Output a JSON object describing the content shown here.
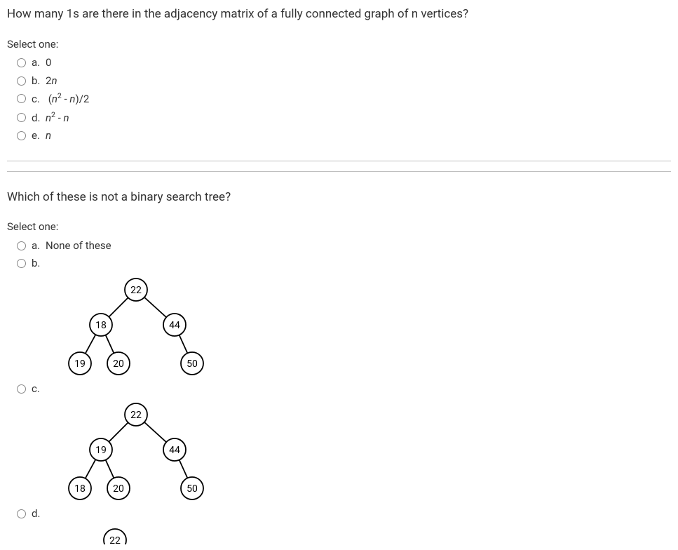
{
  "q1": {
    "text": "How many 1s are there in the adjacency matrix of a fully connected graph of n vertices?",
    "select": "Select one:",
    "opt_a": "0",
    "opt_b": "2n",
    "opt_c": "(n² - n)/2",
    "opt_d": "n² - n",
    "opt_e": "n"
  },
  "q2": {
    "text": "Which of these is not a binary search tree?",
    "select": "Select one:",
    "opt_a": "None of these"
  },
  "trees": {
    "tree_b": {
      "root": "22",
      "left": "18",
      "right": "44",
      "ll": "19",
      "lr": "20",
      "rr": "50"
    },
    "tree_c": {
      "root": "22",
      "left": "19",
      "right": "44",
      "ll": "18",
      "lr": "20",
      "rr": "50"
    },
    "tree_d_root": "22"
  }
}
